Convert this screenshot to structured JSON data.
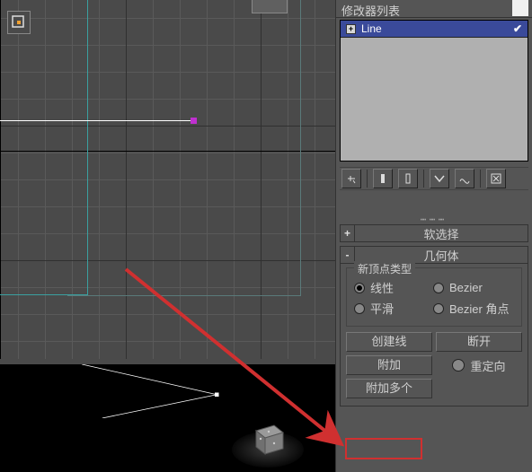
{
  "modifier_list": {
    "header": "修改器列表",
    "items": [
      {
        "label": "Line",
        "expanded": false,
        "active": true
      }
    ]
  },
  "toolbar_icons": [
    "pin",
    "stack-1",
    "stack-2",
    "sep",
    "show-end",
    "curve",
    "sep",
    "remove"
  ],
  "rollups": {
    "soft_select": {
      "toggle": "+",
      "title": "软选择"
    },
    "geometry": {
      "toggle": "-",
      "title": "几何体",
      "new_vertex_group": {
        "title": "新顶点类型",
        "options": {
          "linear": "线性",
          "smooth": "平滑",
          "bezier": "Bezier",
          "bezier_corner": "Bezier 角点"
        },
        "selected": "linear"
      },
      "buttons": {
        "create_line": "创建线",
        "break": "断开",
        "attach": "附加",
        "attach_multiple": "附加多个",
        "reorient": "重定向"
      },
      "reorient_checked": false
    }
  }
}
